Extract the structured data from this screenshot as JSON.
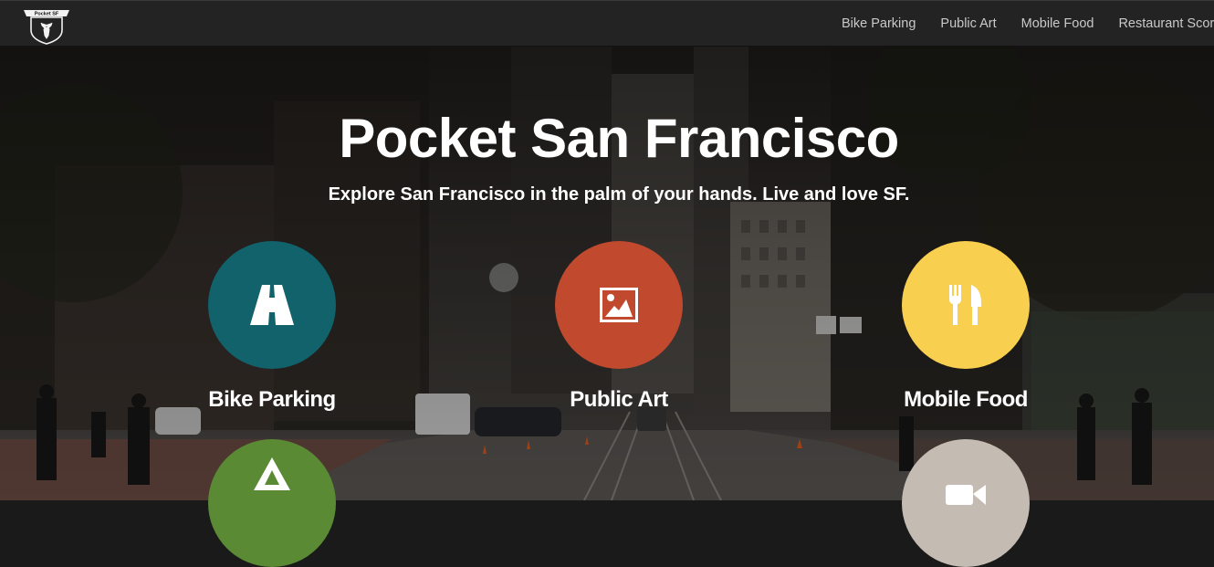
{
  "brand": {
    "logo_text": "Pocket SF",
    "logo_icon": "deer-shield-icon"
  },
  "nav": {
    "items": [
      {
        "label": "Bike Parking"
      },
      {
        "label": "Public Art"
      },
      {
        "label": "Mobile Food"
      },
      {
        "label": "Restaurant Scores"
      }
    ]
  },
  "hero": {
    "title": "Pocket San Francisco",
    "subtitle": "Explore San Francisco in the palm of your hands. Live and love SF."
  },
  "features": [
    {
      "label": "Bike Parking",
      "icon": "road-icon",
      "color": "#11626b"
    },
    {
      "label": "Public Art",
      "icon": "picture-icon",
      "color": "#c0492e"
    },
    {
      "label": "Mobile Food",
      "icon": "fork-knife-icon",
      "color": "#f9cf50"
    },
    {
      "label": "",
      "icon": "triangle-icon",
      "color": "#5a8a34"
    },
    {
      "label": "",
      "icon": "video-camera-icon",
      "color": "#c4bcb2"
    }
  ]
}
